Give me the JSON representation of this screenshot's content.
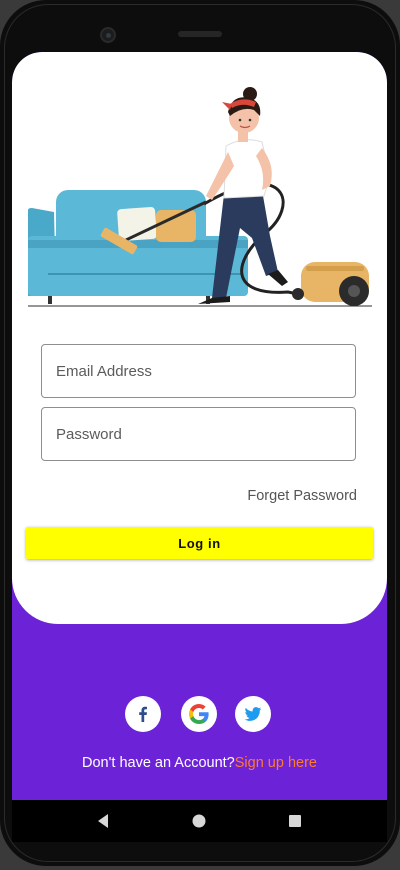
{
  "form": {
    "email_placeholder": "Email Address",
    "password_placeholder": "Password",
    "forget_label": "Forget Password",
    "login_label": "Log in"
  },
  "social": {
    "icons": [
      "facebook-icon",
      "google-icon",
      "twitter-icon"
    ]
  },
  "footer": {
    "prompt": "Don't have an Account?",
    "signup_label": "Sign up here"
  },
  "colors": {
    "accent_purple": "#6c22d6",
    "button_yellow": "#ffff00",
    "link_orange": "#ff7a2e"
  }
}
